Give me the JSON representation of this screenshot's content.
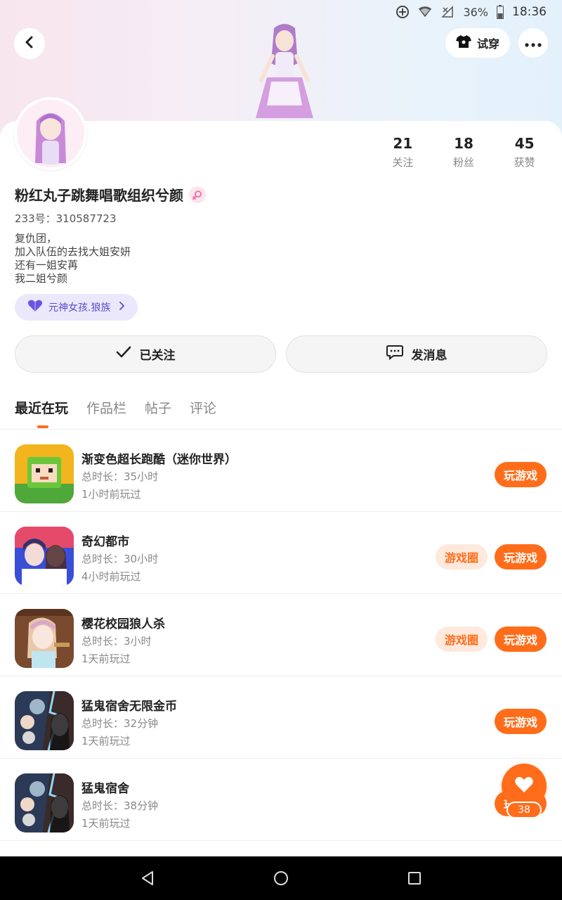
{
  "status_bar": {
    "battery": "36%",
    "time": "18:36"
  },
  "header": {
    "try_on_label": "试穿"
  },
  "profile": {
    "stats": [
      {
        "num": "21",
        "label": "关注"
      },
      {
        "num": "18",
        "label": "粉丝"
      },
      {
        "num": "45",
        "label": "获赞"
      }
    ],
    "nickname": "粉红丸子跳舞唱歌组织兮颜",
    "uid": "233号：310587723",
    "bio": [
      "复仇团，",
      "加入队伍的去找大姐安妍",
      "还有一姐安苒",
      "我二姐兮颜"
    ],
    "tag": "元神女孩.狼族",
    "follow_label": "已关注",
    "message_label": "发消息"
  },
  "tabs": [
    "最近在玩",
    "作品栏",
    "帖子",
    "评论"
  ],
  "games": [
    {
      "title": "渐变色超长跑酷（迷你世界）",
      "duration": "总时长：35小时",
      "last_played": "1小时前玩过",
      "circle": null,
      "play": "玩游戏",
      "icon": "mini-world-icon"
    },
    {
      "title": "奇幻都市",
      "duration": "总时长：30小时",
      "last_played": "4小时前玩过",
      "circle": "游戏圈",
      "play": "玩游戏",
      "icon": "fantasy-city-icon"
    },
    {
      "title": "樱花校园狼人杀",
      "duration": "总时长：3小时",
      "last_played": "1天前玩过",
      "circle": "游戏圈",
      "play": "玩游戏",
      "icon": "sakura-school-icon"
    },
    {
      "title": "猛鬼宿舍无限金币",
      "duration": "总时长：32分钟",
      "last_played": "1天前玩过",
      "circle": null,
      "play": "玩游戏",
      "icon": "ghost-dorm-icon"
    },
    {
      "title": "猛鬼宿舍",
      "duration": "总时长：38分钟",
      "last_played": "1天前玩过",
      "circle": null,
      "play": "玩游戏",
      "icon": "ghost-dorm-icon"
    }
  ],
  "fab": {
    "count": "38"
  },
  "colors": {
    "accent": "#ff6d1a",
    "tag_text": "#5b4bd1"
  }
}
